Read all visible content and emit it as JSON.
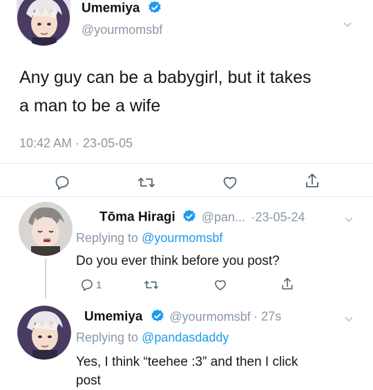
{
  "main_tweet": {
    "name": "Umemiya",
    "handle": "@yourmomsbf",
    "text_line1": "Any guy can be a babygirl, but it takes",
    "text_line2": "a man to be a wife",
    "timestamp": "10:42 AM · 23-05-05"
  },
  "reply1": {
    "name": "Tōma Hiragi",
    "handle": "@pan...",
    "date": "·23-05-24",
    "replying_prefix": "Replying to ",
    "replying_to": "@yourmomsbf",
    "text": "Do you ever think before you post?",
    "reply_count": "1"
  },
  "reply2": {
    "name": "Umemiya",
    "handle": "@yourmomsbf",
    "time": "· 27s",
    "replying_prefix": "Replying to ",
    "replying_to": "@pandasdaddy",
    "text_line1": "Yes, I think “teehee :3” and then I click",
    "text_line2": "post"
  },
  "icons": {
    "verified": "verified-badge-icon",
    "reply": "reply-icon",
    "retweet": "retweet-icon",
    "like": "heart-icon",
    "share": "share-icon",
    "more": "chevron-down-icon"
  },
  "colors": {
    "accent": "#1d9bf0",
    "text": "#14171a",
    "muted": "#8b98a5"
  }
}
